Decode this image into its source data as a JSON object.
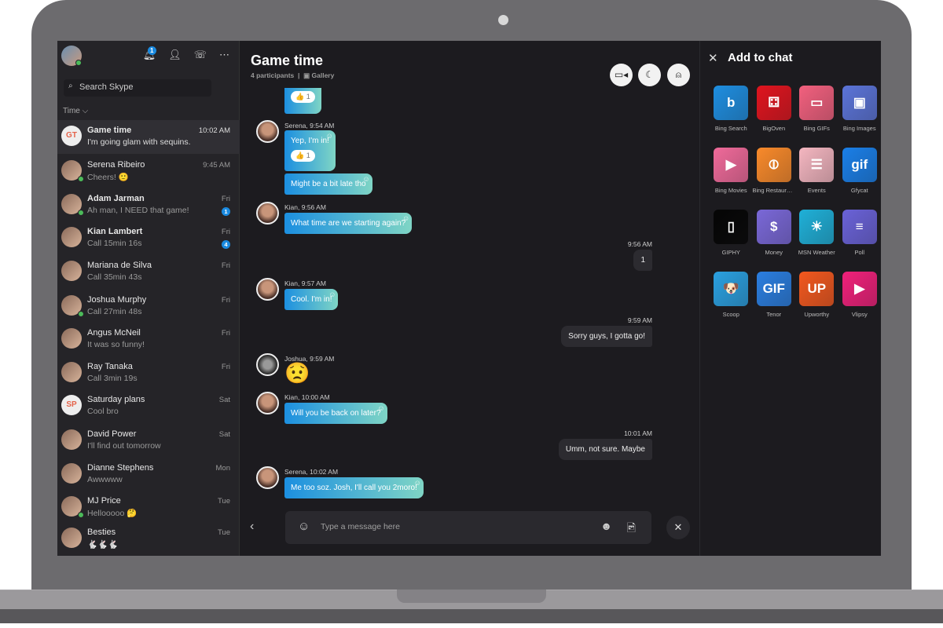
{
  "sidebar": {
    "search_placeholder": "Search Skype",
    "sort_label": "Time ⌵",
    "notification_count": "1",
    "conversations": [
      {
        "name": "Game time",
        "initials": "GT",
        "preview": "I'm going glam with sequins.",
        "time": "10:02 AM",
        "bold": true,
        "selected": true
      },
      {
        "name": "Serena Ribeiro",
        "preview": "Cheers! 🙂",
        "time": "9:45 AM",
        "online": true
      },
      {
        "name": "Adam Jarman",
        "preview": "Ah man, I NEED that game!",
        "time": "Fri",
        "bold": true,
        "unread": "1",
        "online": true
      },
      {
        "name": "Kian Lambert",
        "preview": "Call 15min 16s",
        "time": "Fri",
        "bold": true,
        "unread": "4"
      },
      {
        "name": "Mariana de Silva",
        "preview": "Call 35min 43s",
        "time": "Fri"
      },
      {
        "name": "Joshua Murphy",
        "preview": "Call 27min 48s",
        "time": "Fri",
        "online": true
      },
      {
        "name": "Angus McNeil",
        "preview": "It was so funny!",
        "time": "Fri"
      },
      {
        "name": "Ray Tanaka",
        "preview": "Call 3min 19s",
        "time": "Fri"
      },
      {
        "name": "Saturday plans",
        "initials": "SP",
        "preview": "Cool bro",
        "time": "Sat"
      },
      {
        "name": "David Power",
        "preview": "I'll find out tomorrow",
        "time": "Sat"
      },
      {
        "name": "Dianne Stephens",
        "preview": "Awwwww",
        "time": "Mon"
      },
      {
        "name": "MJ Price",
        "preview": "Hellooooo 🤔",
        "time": "Tue",
        "online": true
      },
      {
        "name": "Besties",
        "preview": "🐇🐇🐇",
        "time": "Tue"
      }
    ]
  },
  "chat": {
    "title": "Game time",
    "participants": "4 participants",
    "gallery": "Gallery",
    "top_reaction": "👍 1",
    "messages": [
      {
        "sender": "Serena, 9:54 AM",
        "text": "Yep, I'm in!",
        "reaction": "👍 1"
      },
      {
        "text": "Might be a bit late tho"
      },
      {
        "sender": "Kian, 9:56 AM",
        "text": "What time are we starting again?"
      },
      {
        "time": "9:56 AM",
        "text": "1",
        "mine": true
      },
      {
        "sender": "Kian, 9:57 AM",
        "text": "Cool. I'm in!"
      },
      {
        "time": "9:59 AM",
        "text": "Sorry guys, I gotta go!",
        "mine": true
      },
      {
        "sender": "Joshua, 9:59 AM",
        "text": "😟"
      },
      {
        "sender": "Kian, 10:00 AM",
        "text": "Will you be back on later?"
      },
      {
        "time": "10:01 AM",
        "text": "Umm, not sure. Maybe",
        "mine": true
      },
      {
        "sender": "Serena, 10:02 AM",
        "text": "Me too soz. Josh, I'll call you 2moro!"
      }
    ],
    "composer_placeholder": "Type a message here"
  },
  "panel": {
    "title": "Add to chat",
    "apps": [
      {
        "name": "Bing Search",
        "glyph": "b",
        "color": "#1e8ee0"
      },
      {
        "name": "BigOven",
        "glyph": "⚃",
        "color": "#e0141e"
      },
      {
        "name": "Bing GIFs",
        "glyph": "▭",
        "color": "#f2607e"
      },
      {
        "name": "Bing Images",
        "glyph": "▣",
        "color": "#5b74d8"
      },
      {
        "name": "Bing Movies",
        "glyph": "▶",
        "color": "#f06a9a"
      },
      {
        "name": "Bing Restaurants",
        "glyph": "⦶",
        "color": "#f98a2a"
      },
      {
        "name": "Events",
        "glyph": "☰",
        "color": "#f4b6c0"
      },
      {
        "name": "Gfycat",
        "glyph": "gif",
        "color": "#1a7fe8"
      },
      {
        "name": "GIPHY",
        "glyph": "▯",
        "color": "#050505"
      },
      {
        "name": "Money",
        "glyph": "$",
        "color": "#7a68d8"
      },
      {
        "name": "MSN Weather",
        "glyph": "☀",
        "color": "#1fb0d8"
      },
      {
        "name": "Poll",
        "glyph": "≡",
        "color": "#6a62d8"
      },
      {
        "name": "Scoop",
        "glyph": "🐶",
        "color": "#2aa0e0"
      },
      {
        "name": "Tenor",
        "glyph": "GIF",
        "color": "#2a7ee0"
      },
      {
        "name": "Upworthy",
        "glyph": "UP",
        "color": "#f2581e"
      },
      {
        "name": "Vlipsy",
        "glyph": "▶",
        "color": "#f0207a"
      }
    ]
  }
}
